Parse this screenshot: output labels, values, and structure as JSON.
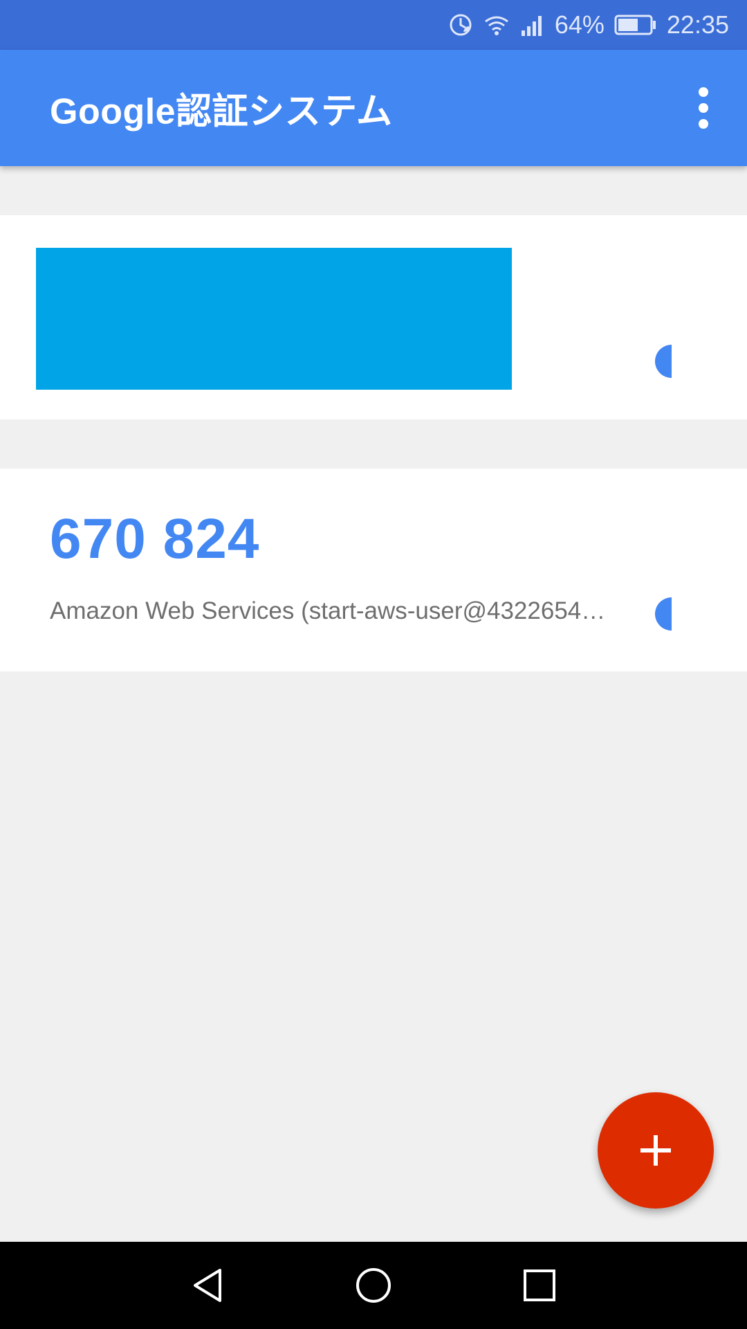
{
  "status_bar": {
    "battery_percent": "64%",
    "battery_level": 0.64,
    "time": "22:35"
  },
  "app_bar": {
    "title": "Google認証システム"
  },
  "accounts": [
    {
      "code": "",
      "name": "",
      "redacted": true
    },
    {
      "code": "670 824",
      "name": "Amazon Web Services (start-aws-user@4322654…",
      "redacted": false
    }
  ],
  "fab": {
    "icon": "plus-icon"
  },
  "colors": {
    "status_bar": "#3a6dd6",
    "app_bar": "#4387f3",
    "accent": "#4387f3",
    "redaction": "#01a4e6",
    "fab": "#dd2c00",
    "background": "#f0f0f0"
  }
}
